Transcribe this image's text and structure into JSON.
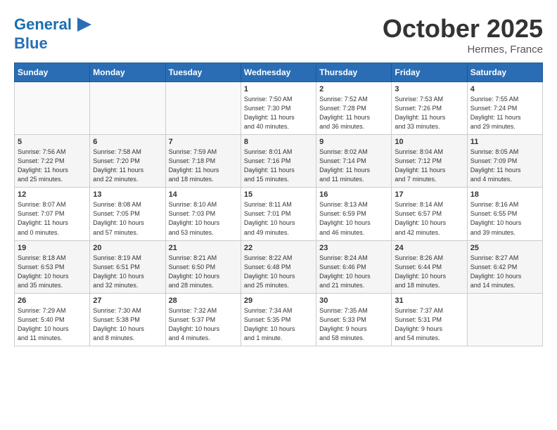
{
  "header": {
    "logo_line1": "General",
    "logo_line2": "Blue",
    "month": "October 2025",
    "location": "Hermes, France"
  },
  "weekdays": [
    "Sunday",
    "Monday",
    "Tuesday",
    "Wednesday",
    "Thursday",
    "Friday",
    "Saturday"
  ],
  "weeks": [
    [
      {
        "day": "",
        "info": ""
      },
      {
        "day": "",
        "info": ""
      },
      {
        "day": "",
        "info": ""
      },
      {
        "day": "1",
        "info": "Sunrise: 7:50 AM\nSunset: 7:30 PM\nDaylight: 11 hours\nand 40 minutes."
      },
      {
        "day": "2",
        "info": "Sunrise: 7:52 AM\nSunset: 7:28 PM\nDaylight: 11 hours\nand 36 minutes."
      },
      {
        "day": "3",
        "info": "Sunrise: 7:53 AM\nSunset: 7:26 PM\nDaylight: 11 hours\nand 33 minutes."
      },
      {
        "day": "4",
        "info": "Sunrise: 7:55 AM\nSunset: 7:24 PM\nDaylight: 11 hours\nand 29 minutes."
      }
    ],
    [
      {
        "day": "5",
        "info": "Sunrise: 7:56 AM\nSunset: 7:22 PM\nDaylight: 11 hours\nand 25 minutes."
      },
      {
        "day": "6",
        "info": "Sunrise: 7:58 AM\nSunset: 7:20 PM\nDaylight: 11 hours\nand 22 minutes."
      },
      {
        "day": "7",
        "info": "Sunrise: 7:59 AM\nSunset: 7:18 PM\nDaylight: 11 hours\nand 18 minutes."
      },
      {
        "day": "8",
        "info": "Sunrise: 8:01 AM\nSunset: 7:16 PM\nDaylight: 11 hours\nand 15 minutes."
      },
      {
        "day": "9",
        "info": "Sunrise: 8:02 AM\nSunset: 7:14 PM\nDaylight: 11 hours\nand 11 minutes."
      },
      {
        "day": "10",
        "info": "Sunrise: 8:04 AM\nSunset: 7:12 PM\nDaylight: 11 hours\nand 7 minutes."
      },
      {
        "day": "11",
        "info": "Sunrise: 8:05 AM\nSunset: 7:09 PM\nDaylight: 11 hours\nand 4 minutes."
      }
    ],
    [
      {
        "day": "12",
        "info": "Sunrise: 8:07 AM\nSunset: 7:07 PM\nDaylight: 11 hours\nand 0 minutes."
      },
      {
        "day": "13",
        "info": "Sunrise: 8:08 AM\nSunset: 7:05 PM\nDaylight: 10 hours\nand 57 minutes."
      },
      {
        "day": "14",
        "info": "Sunrise: 8:10 AM\nSunset: 7:03 PM\nDaylight: 10 hours\nand 53 minutes."
      },
      {
        "day": "15",
        "info": "Sunrise: 8:11 AM\nSunset: 7:01 PM\nDaylight: 10 hours\nand 49 minutes."
      },
      {
        "day": "16",
        "info": "Sunrise: 8:13 AM\nSunset: 6:59 PM\nDaylight: 10 hours\nand 46 minutes."
      },
      {
        "day": "17",
        "info": "Sunrise: 8:14 AM\nSunset: 6:57 PM\nDaylight: 10 hours\nand 42 minutes."
      },
      {
        "day": "18",
        "info": "Sunrise: 8:16 AM\nSunset: 6:55 PM\nDaylight: 10 hours\nand 39 minutes."
      }
    ],
    [
      {
        "day": "19",
        "info": "Sunrise: 8:18 AM\nSunset: 6:53 PM\nDaylight: 10 hours\nand 35 minutes."
      },
      {
        "day": "20",
        "info": "Sunrise: 8:19 AM\nSunset: 6:51 PM\nDaylight: 10 hours\nand 32 minutes."
      },
      {
        "day": "21",
        "info": "Sunrise: 8:21 AM\nSunset: 6:50 PM\nDaylight: 10 hours\nand 28 minutes."
      },
      {
        "day": "22",
        "info": "Sunrise: 8:22 AM\nSunset: 6:48 PM\nDaylight: 10 hours\nand 25 minutes."
      },
      {
        "day": "23",
        "info": "Sunrise: 8:24 AM\nSunset: 6:46 PM\nDaylight: 10 hours\nand 21 minutes."
      },
      {
        "day": "24",
        "info": "Sunrise: 8:26 AM\nSunset: 6:44 PM\nDaylight: 10 hours\nand 18 minutes."
      },
      {
        "day": "25",
        "info": "Sunrise: 8:27 AM\nSunset: 6:42 PM\nDaylight: 10 hours\nand 14 minutes."
      }
    ],
    [
      {
        "day": "26",
        "info": "Sunrise: 7:29 AM\nSunset: 5:40 PM\nDaylight: 10 hours\nand 11 minutes."
      },
      {
        "day": "27",
        "info": "Sunrise: 7:30 AM\nSunset: 5:38 PM\nDaylight: 10 hours\nand 8 minutes."
      },
      {
        "day": "28",
        "info": "Sunrise: 7:32 AM\nSunset: 5:37 PM\nDaylight: 10 hours\nand 4 minutes."
      },
      {
        "day": "29",
        "info": "Sunrise: 7:34 AM\nSunset: 5:35 PM\nDaylight: 10 hours\nand 1 minute."
      },
      {
        "day": "30",
        "info": "Sunrise: 7:35 AM\nSunset: 5:33 PM\nDaylight: 9 hours\nand 58 minutes."
      },
      {
        "day": "31",
        "info": "Sunrise: 7:37 AM\nSunset: 5:31 PM\nDaylight: 9 hours\nand 54 minutes."
      },
      {
        "day": "",
        "info": ""
      }
    ]
  ]
}
